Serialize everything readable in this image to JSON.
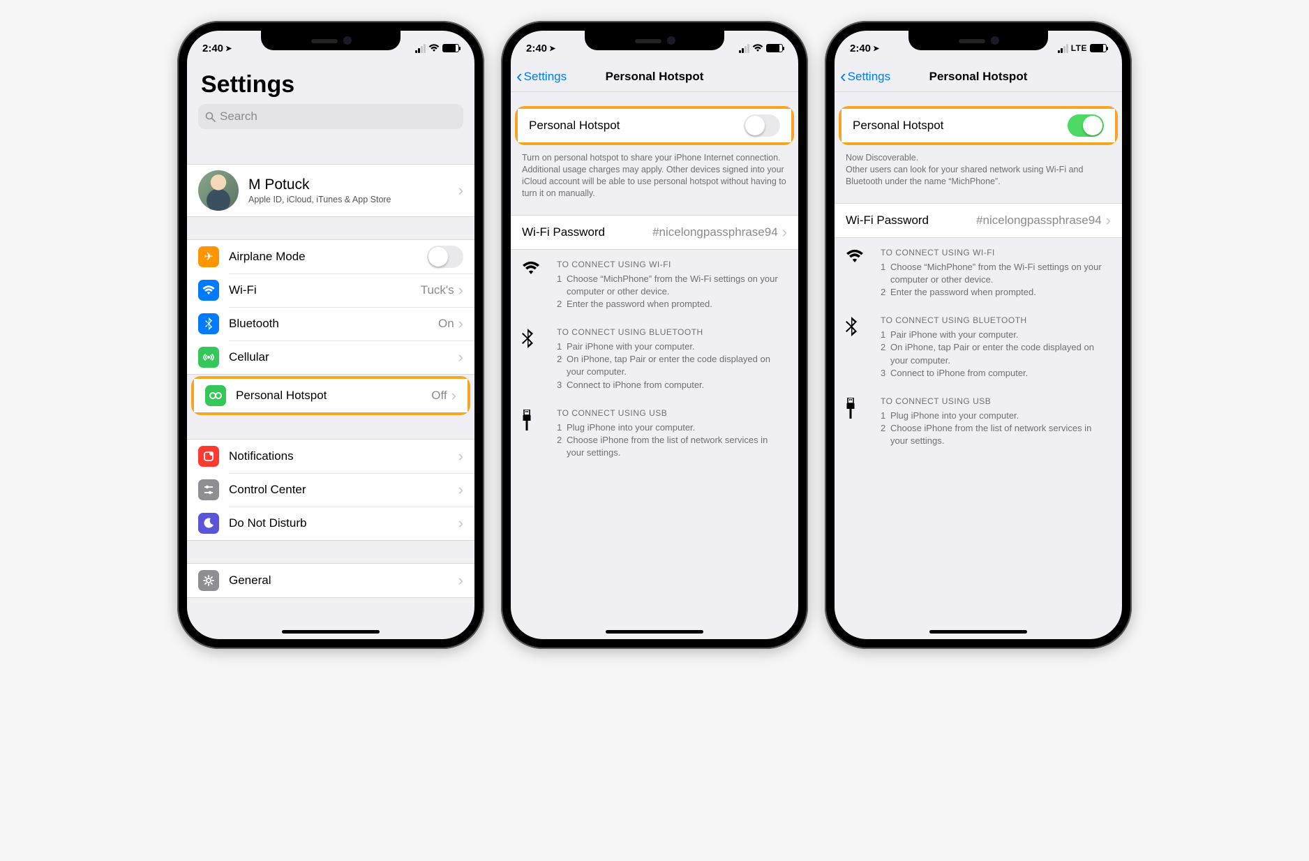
{
  "status": {
    "time": "2:40",
    "lte": "LTE"
  },
  "screen1": {
    "title": "Settings",
    "search_placeholder": "Search",
    "account": {
      "name": "M Potuck",
      "subtitle": "Apple ID, iCloud, iTunes & App Store"
    },
    "rows": {
      "airplane": "Airplane Mode",
      "wifi": "Wi-Fi",
      "wifi_value": "Tuck's",
      "bluetooth": "Bluetooth",
      "bluetooth_value": "On",
      "cellular": "Cellular",
      "hotspot": "Personal Hotspot",
      "hotspot_value": "Off",
      "notifications": "Notifications",
      "control_center": "Control Center",
      "dnd": "Do Not Disturb",
      "general": "General"
    }
  },
  "screen2": {
    "back": "Settings",
    "title": "Personal Hotspot",
    "toggle_label": "Personal Hotspot",
    "footer": "Turn on personal hotspot to share your iPhone Internet connection. Additional usage charges may apply. Other devices signed into your iCloud account will be able to use personal hotspot without having to turn it on manually.",
    "wifi_pw_label": "Wi-Fi Password",
    "wifi_pw_value": "#nicelongpassphrase94",
    "instructions": {
      "wifi_title": "TO CONNECT USING WI-FI",
      "wifi_1": "Choose “MichPhone” from the Wi-Fi settings on your computer or other device.",
      "wifi_2": "Enter the password when prompted.",
      "bt_title": "TO CONNECT USING BLUETOOTH",
      "bt_1": "Pair iPhone with your computer.",
      "bt_2": "On iPhone, tap Pair or enter the code displayed on your computer.",
      "bt_3": "Connect to iPhone from computer.",
      "usb_title": "TO CONNECT USING USB",
      "usb_1": "Plug iPhone into your computer.",
      "usb_2": "Choose iPhone from the list of network services in your settings."
    }
  },
  "screen3": {
    "back": "Settings",
    "title": "Personal Hotspot",
    "toggle_label": "Personal Hotspot",
    "footer_line1": "Now Discoverable.",
    "footer_line2": "Other users can look for your shared network using Wi-Fi and Bluetooth under the name “MichPhone”.",
    "wifi_pw_label": "Wi-Fi Password",
    "wifi_pw_value": "#nicelongpassphrase94"
  }
}
